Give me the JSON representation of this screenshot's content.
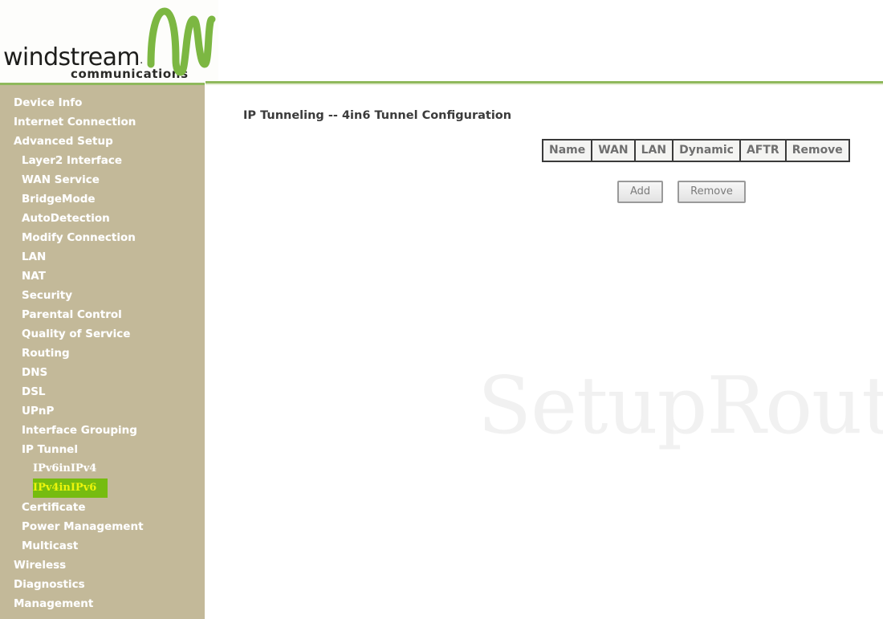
{
  "branding": {
    "wordmark": "windstream",
    "trademark": ".",
    "tagline": "communications",
    "logo_icon": "windstream-wave-w-icon",
    "accent_green": "#8fb95c",
    "logo_green": "#7cb742"
  },
  "sidebar": {
    "background_color": "#c3b999",
    "selected_bg": "#76bc10",
    "selected_fg": "#ecf50c",
    "items": [
      {
        "label": "Device Info",
        "level": 0,
        "selected": false
      },
      {
        "label": "Internet Connection",
        "level": 0,
        "selected": false
      },
      {
        "label": "Advanced Setup",
        "level": 0,
        "selected": false
      },
      {
        "label": "Layer2 Interface",
        "level": 1,
        "selected": false
      },
      {
        "label": "WAN Service",
        "level": 1,
        "selected": false
      },
      {
        "label": "BridgeMode",
        "level": 1,
        "selected": false
      },
      {
        "label": "AutoDetection",
        "level": 1,
        "selected": false
      },
      {
        "label": "Modify Connection",
        "level": 1,
        "selected": false
      },
      {
        "label": "LAN",
        "level": 1,
        "selected": false
      },
      {
        "label": "NAT",
        "level": 1,
        "selected": false
      },
      {
        "label": "Security",
        "level": 1,
        "selected": false
      },
      {
        "label": "Parental Control",
        "level": 1,
        "selected": false
      },
      {
        "label": "Quality of Service",
        "level": 1,
        "selected": false
      },
      {
        "label": "Routing",
        "level": 1,
        "selected": false
      },
      {
        "label": "DNS",
        "level": 1,
        "selected": false
      },
      {
        "label": "DSL",
        "level": 1,
        "selected": false
      },
      {
        "label": "UPnP",
        "level": 1,
        "selected": false
      },
      {
        "label": "Interface Grouping",
        "level": 1,
        "selected": false
      },
      {
        "label": "IP Tunnel",
        "level": 1,
        "selected": false
      },
      {
        "label": "IPv6inIPv4",
        "level": 2,
        "selected": false
      },
      {
        "label": "IPv4inIPv6",
        "level": 2,
        "selected": true
      },
      {
        "label": "Certificate",
        "level": 1,
        "selected": false
      },
      {
        "label": "Power Management",
        "level": 1,
        "selected": false
      },
      {
        "label": "Multicast",
        "level": 1,
        "selected": false
      },
      {
        "label": "Wireless",
        "level": 0,
        "selected": false
      },
      {
        "label": "Diagnostics",
        "level": 0,
        "selected": false
      },
      {
        "label": "Management",
        "level": 0,
        "selected": false
      }
    ]
  },
  "main": {
    "page_title": "IP Tunneling -- 4in6 Tunnel Configuration",
    "table": {
      "columns": [
        "Name",
        "WAN",
        "LAN",
        "Dynamic",
        "AFTR",
        "Remove"
      ],
      "rows": []
    },
    "buttons": [
      {
        "label": "Add",
        "name": "add-button"
      },
      {
        "label": "Remove",
        "name": "remove-button"
      }
    ]
  },
  "watermark": {
    "text": "SetupRouter.com"
  }
}
